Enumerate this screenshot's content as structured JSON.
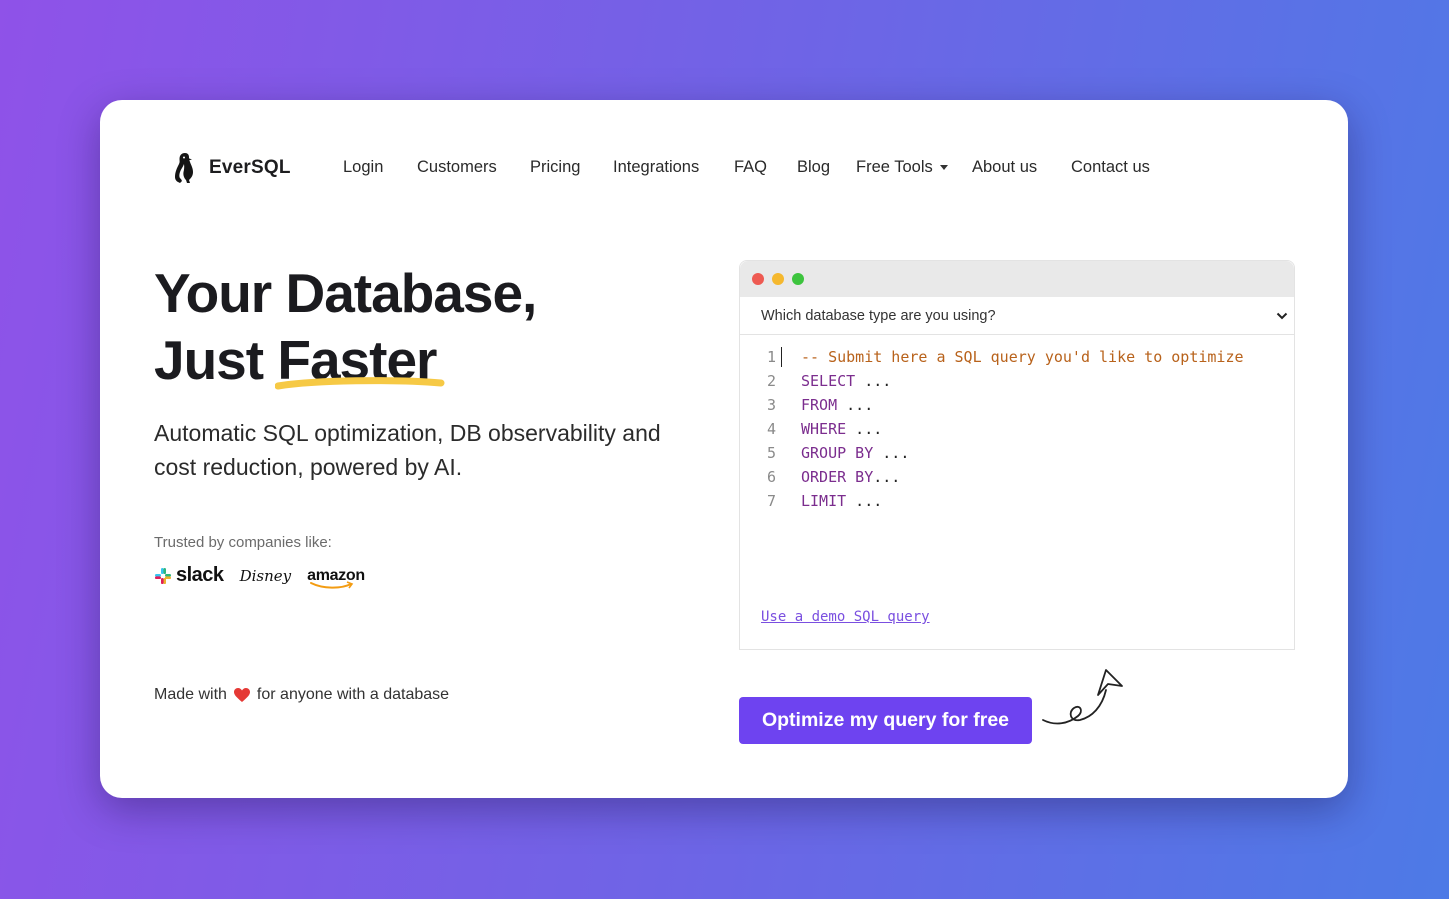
{
  "brand": {
    "name": "EverSQL",
    "icon": "penguin-icon"
  },
  "nav": {
    "items": [
      {
        "label": "Login",
        "name": "nav-login"
      },
      {
        "label": "Customers",
        "name": "nav-customers"
      },
      {
        "label": "Pricing",
        "name": "nav-pricing"
      },
      {
        "label": "Integrations",
        "name": "nav-integrations"
      },
      {
        "label": "FAQ",
        "name": "nav-faq"
      },
      {
        "label": "Blog",
        "name": "nav-blog"
      },
      {
        "label": "Free Tools",
        "name": "nav-free-tools",
        "dropdown": true
      },
      {
        "label": "About us",
        "name": "nav-about"
      },
      {
        "label": "Contact us",
        "name": "nav-contact"
      }
    ]
  },
  "hero": {
    "title_line1": "Your Database,",
    "title_line2_prefix": "Just ",
    "title_line2_highlight": "Faster",
    "subtitle": "Automatic SQL optimization, DB observability and cost reduction, powered by AI.",
    "trusted_label": "Trusted by companies like:",
    "logos": [
      "slack",
      "Disney",
      "amazon"
    ],
    "made_with_prefix": "Made with",
    "made_with_suffix": "for anyone with a database"
  },
  "editor": {
    "db_select_placeholder": "Which database type are you using?",
    "lines": [
      {
        "num": "1",
        "tokens": [
          {
            "t": "-- Submit here a SQL query you'd like to optimize",
            "c": "comment"
          }
        ]
      },
      {
        "num": "2",
        "tokens": [
          {
            "t": "SELECT",
            "c": "kw"
          },
          {
            "t": " ...",
            "c": "plain"
          }
        ]
      },
      {
        "num": "3",
        "tokens": [
          {
            "t": "FROM",
            "c": "kw"
          },
          {
            "t": " ...",
            "c": "plain"
          }
        ]
      },
      {
        "num": "4",
        "tokens": [
          {
            "t": "WHERE",
            "c": "kw"
          },
          {
            "t": " ...",
            "c": "plain"
          }
        ]
      },
      {
        "num": "5",
        "tokens": [
          {
            "t": "GROUP BY",
            "c": "kw"
          },
          {
            "t": " ...",
            "c": "plain"
          }
        ]
      },
      {
        "num": "6",
        "tokens": [
          {
            "t": "ORDER BY",
            "c": "kw"
          },
          {
            "t": "...",
            "c": "plain"
          }
        ]
      },
      {
        "num": "7",
        "tokens": [
          {
            "t": "LIMIT",
            "c": "kw"
          },
          {
            "t": " ...",
            "c": "plain"
          }
        ]
      }
    ],
    "demo_link": "Use a demo SQL query"
  },
  "cta": {
    "label": "Optimize my query for free"
  },
  "colors": {
    "accent": "#6e43f0",
    "underline": "#f6c945",
    "dot_red": "#ee5a52",
    "dot_yellow": "#f5b82e",
    "dot_green": "#3dc43e",
    "heart": "#e53935"
  }
}
